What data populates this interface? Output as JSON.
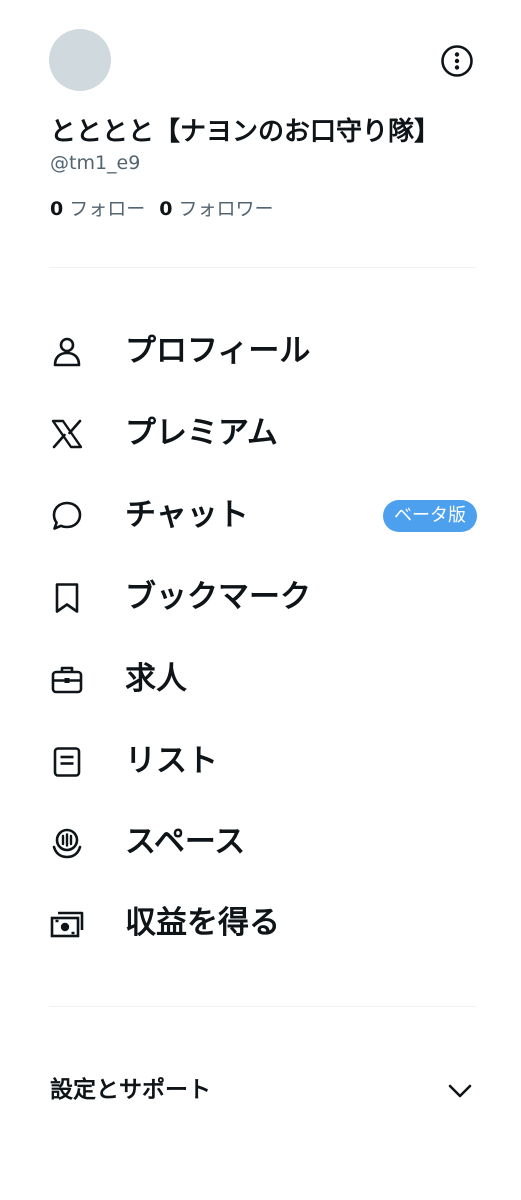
{
  "profile": {
    "display_name": "とととと【ナヨンのお口守り隊】",
    "handle": "@tm1_e9",
    "following_count": "0",
    "following_label": "フォロー",
    "followers_count": "0",
    "followers_label": "フォロワー"
  },
  "menu": [
    {
      "label": "プロフィール",
      "icon": "person-icon"
    },
    {
      "label": "プレミアム",
      "icon": "x-logo-icon"
    },
    {
      "label": "チャット",
      "icon": "chat-bubble-icon",
      "badge": "ベータ版"
    },
    {
      "label": "ブックマーク",
      "icon": "bookmark-icon"
    },
    {
      "label": "求人",
      "icon": "briefcase-icon"
    },
    {
      "label": "リスト",
      "icon": "list-icon"
    },
    {
      "label": "スペース",
      "icon": "spaces-icon"
    },
    {
      "label": "収益を得る",
      "icon": "money-icon"
    }
  ],
  "settings": {
    "label": "設定とサポート",
    "icon": "chevron-down-icon"
  },
  "colors": {
    "text": "#0f1419",
    "secondary": "#536471",
    "avatar": "#cfd9de",
    "divider": "#eff3f4",
    "badge": "#4da0ee"
  }
}
